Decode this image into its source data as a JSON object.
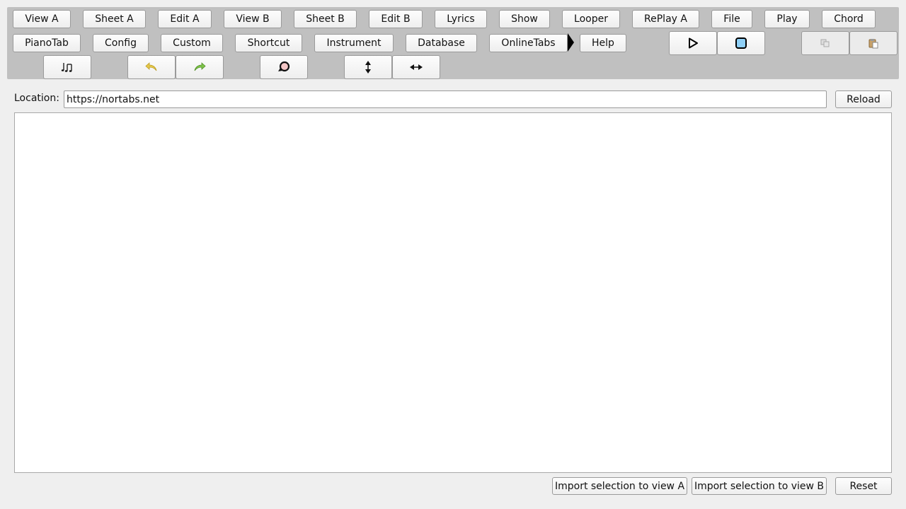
{
  "toolbar": {
    "row1": [
      "View A",
      "Sheet A",
      "Edit A",
      "View B",
      "Sheet B",
      "Edit B",
      "Lyrics",
      "Show",
      "Looper",
      "RePlay A",
      "File",
      "Play",
      "Chord"
    ],
    "row2": [
      "PianoTab",
      "Config",
      "Custom",
      "Shortcut",
      "Instrument",
      "Database",
      "OnlineTabs",
      "Help"
    ],
    "icons": {
      "notes": "music-notes-icon",
      "undo": "undo-icon",
      "redo": "redo-icon",
      "refresh": "refresh-icon",
      "vertical": "vertical-resize-icon",
      "horizontal": "horizontal-resize-icon",
      "play": "play-icon",
      "stop": "stop-icon",
      "copy": "copy-icon",
      "paste": "paste-icon"
    }
  },
  "location": {
    "label": "Location:",
    "value": "https://nortabs.net",
    "reload_label": "Reload"
  },
  "footer": {
    "import_a": "Import selection to view A",
    "import_b": "Import selection to view B",
    "reset": "Reset"
  },
  "colors": {
    "toolbar_bg": "#c0c0c0",
    "window_bg": "#efefef",
    "stop_fill": "#8fd0f7",
    "undo_arrow": "#e6c84a",
    "redo_arrow": "#7fc44b"
  }
}
